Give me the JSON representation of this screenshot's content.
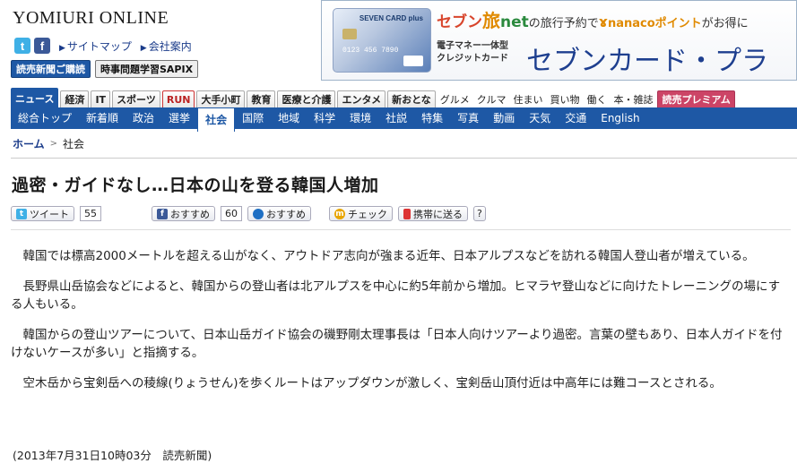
{
  "header": {
    "logo": "YOMIURI ONLINE",
    "links": [
      "サイトマップ",
      "会社案内"
    ],
    "pills": [
      "読売新聞ご購読",
      "時事問題学習SAPIX"
    ]
  },
  "ad": {
    "top_seven": "セブン",
    "top_tabi": "旅",
    "top_net": "net",
    "top_mid": "の旅行予約で",
    "top_nanaco": "nanacoポイント",
    "top_end": "がお得に",
    "sub_line1": "電子マネー一体型",
    "sub_line2": "クレジットカード",
    "big": "セブンカード・プラ",
    "card_name": "SEVEN CARD plus",
    "card_number": "0123 456 7890"
  },
  "categories": [
    "ニュース",
    "経済",
    "IT",
    "スポーツ",
    "RUN",
    "大手小町",
    "教育",
    "医療と介護",
    "エンタメ",
    "新おとな",
    "グルメ",
    "クルマ",
    "住まい",
    "買い物",
    "働く",
    "本・雑誌",
    "読売プレミアム"
  ],
  "nav": [
    "総合トップ",
    "新着順",
    "政治",
    "選挙",
    "社会",
    "国際",
    "地域",
    "科学",
    "環境",
    "社説",
    "特集",
    "写真",
    "動画",
    "天気",
    "交通",
    "English"
  ],
  "breadcrumb": {
    "home": "ホーム",
    "current": "社会"
  },
  "article": {
    "title": "過密・ガイドなし…日本の山を登る韓国人増加",
    "paragraphs": [
      "韓国では標高2000メートルを超える山がなく、アウトドア志向が強まる近年、日本アルプスなどを訪れる韓国人登山者が増えている。",
      "長野県山岳協会などによると、韓国からの登山者は北アルプスを中心に約5年前から増加。ヒマラヤ登山などに向けたトレーニングの場にする人もいる。",
      "韓国からの登山ツアーについて、日本山岳ガイド協会の磯野剛太理事長は「日本人向けツアーより過密。言葉の壁もあり、日本人ガイドを付けないケースが多い」と指摘する。",
      "空木岳から宝剣岳への稜線(りょうせん)を歩くルートはアップダウンが激しく、宝剣岳山頂付近は中高年には難コースとされる。"
    ],
    "dateline": "(2013年7月31日10時03分　読売新聞)"
  },
  "share": {
    "tweet_label": "ツイート",
    "tweet_count": "55",
    "fb_label": "おすすめ",
    "fb_count": "60",
    "hex_label": "おすすめ",
    "check_label": "チェック",
    "mobile_label": "携帯に送る",
    "help_label": "?"
  },
  "colors": {
    "brand_blue": "#1e58a5",
    "link": "#1a3b8a"
  }
}
